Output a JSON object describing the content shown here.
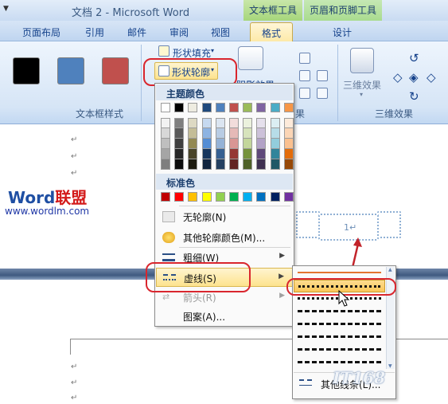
{
  "window": {
    "title": "文档 2 - Microsoft Word",
    "context_tab_textbox": "文本框工具",
    "context_tab_headfoot": "页眉和页脚工具"
  },
  "tabs": [
    "页面布局",
    "引用",
    "邮件",
    "审阅",
    "视图",
    "格式",
    "设计"
  ],
  "ribbon": {
    "group_textbox_styles": "文本框样式",
    "group_3d": "三维效果",
    "shape_fill": "形状填充",
    "shape_outline": "形状轮廓",
    "shadow_partial": "阴影效果",
    "three_d_button": "三维效果",
    "swatch_colors": [
      "#000000",
      "#4f81bd",
      "#c0504d"
    ]
  },
  "menu": {
    "theme_colors_heading": "主题颜色",
    "standard_colors_heading": "标准色",
    "theme_top_row": [
      "#ffffff",
      "#000000",
      "#eeece1",
      "#1f497d",
      "#4f81bd",
      "#c0504d",
      "#9bbb59",
      "#8064a2",
      "#4bacc6",
      "#f79646"
    ],
    "theme_shade_rows": [
      [
        "#f2f2f2",
        "#7f7f7f",
        "#ddd9c3",
        "#c6d9f0",
        "#dbe5f1",
        "#f2dcdb",
        "#ebf1dd",
        "#e5e0ec",
        "#dbeef3",
        "#fdeada"
      ],
      [
        "#d8d8d8",
        "#595959",
        "#c4bd97",
        "#8db3e2",
        "#b8cce4",
        "#e5b9b7",
        "#d7e3bc",
        "#ccc1d9",
        "#b7dde8",
        "#fbd5b5"
      ],
      [
        "#bfbfbf",
        "#3f3f3f",
        "#938953",
        "#548dd4",
        "#95b3d7",
        "#d99694",
        "#c3d69b",
        "#b2a2c7",
        "#92cddc",
        "#fac08f"
      ],
      [
        "#a5a5a5",
        "#262626",
        "#494429",
        "#17365d",
        "#366092",
        "#953734",
        "#76923c",
        "#5f497a",
        "#31859b",
        "#e36c09"
      ],
      [
        "#7f7f7f",
        "#0c0c0c",
        "#1d1b10",
        "#0f243e",
        "#244061",
        "#632423",
        "#4f6128",
        "#3f3151",
        "#205867",
        "#974806"
      ]
    ],
    "standard_colors": [
      "#c00000",
      "#ff0000",
      "#ffc000",
      "#ffff00",
      "#92d050",
      "#00b050",
      "#00b0f0",
      "#0070c0",
      "#002060",
      "#7030a0"
    ],
    "no_outline": "无轮廓(N)",
    "more_colors": "其他轮廓颜色(M)...",
    "weight": "粗细(W)",
    "dashes": "虚线(S)",
    "arrows": "箭头(R)",
    "pattern": "图案(A)..."
  },
  "submenu": {
    "more_lines": "其他线条(L)..."
  },
  "document": {
    "logo_word": "Word",
    "logo_cn": "联盟",
    "logo_url": "www.wordlm.com",
    "paragraph_mark": "↵",
    "shape_text": "1↵"
  },
  "watermark": "IT168"
}
